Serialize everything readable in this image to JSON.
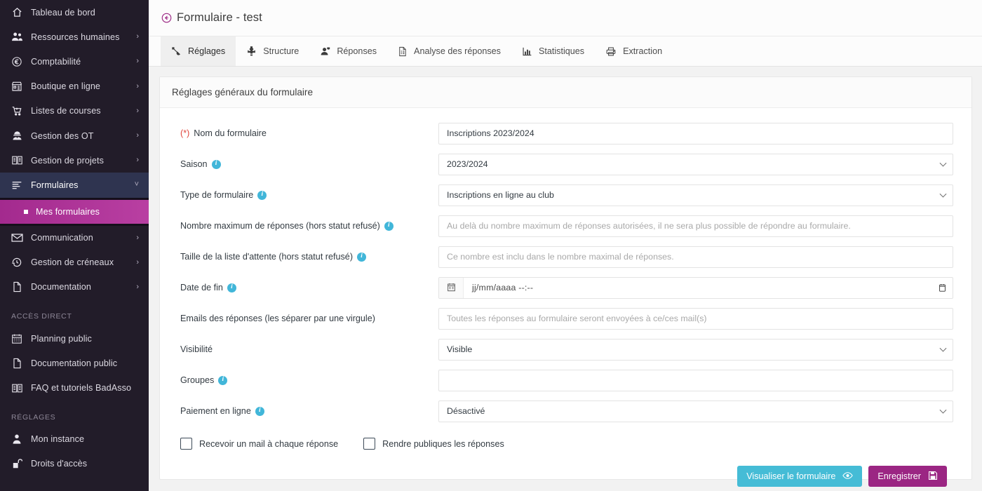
{
  "colors": {
    "sidebar_bg": "#221c29",
    "sidebar_active_parent": "#2f3450",
    "sidebar_active_sub": "#a32a8e",
    "accent_magenta": "#9b2683",
    "accent_cyan": "#45bcd6",
    "info_blue": "#41b6d9",
    "required_red": "#e0473e"
  },
  "sidebar": {
    "items": [
      {
        "label": "Tableau de bord",
        "icon": "home-icon",
        "expandable": false
      },
      {
        "label": "Ressources humaines",
        "icon": "users-icon",
        "expandable": true
      },
      {
        "label": "Comptabilité",
        "icon": "euro-circle-icon",
        "expandable": true
      },
      {
        "label": "Boutique en ligne",
        "icon": "shop-icon",
        "expandable": true
      },
      {
        "label": "Listes de courses",
        "icon": "shopping-cart-icon",
        "expandable": true
      },
      {
        "label": "Gestion des OT",
        "icon": "worker-icon",
        "expandable": true
      },
      {
        "label": "Gestion de projets",
        "icon": "projects-icon",
        "expandable": true
      },
      {
        "label": "Formulaires",
        "icon": "form-lines-icon",
        "expandable": true,
        "active": true
      },
      {
        "label": "Communication",
        "icon": "envelope-icon",
        "expandable": true
      },
      {
        "label": "Gestion de créneaux",
        "icon": "history-clock-icon",
        "expandable": true
      },
      {
        "label": "Documentation",
        "icon": "file-icon",
        "expandable": true
      }
    ],
    "sub_item": {
      "label": "Mes formulaires",
      "icon": "square-bullet-icon"
    },
    "section_acces_direct": "ACCÈS DIRECT",
    "acces_direct_items": [
      {
        "label": "Planning public",
        "icon": "calendar-icon"
      },
      {
        "label": "Documentation public",
        "icon": "file-icon"
      },
      {
        "label": "FAQ et tutoriels BadAsso",
        "icon": "book-icon"
      }
    ],
    "section_reglages": "RÉGLAGES",
    "reglages_items": [
      {
        "label": "Mon instance",
        "icon": "person-icon"
      },
      {
        "label": "Droits d'accès",
        "icon": "unlock-icon"
      }
    ]
  },
  "header": {
    "title": "Formulaire - test",
    "back_icon": "back-circle-arrow-icon"
  },
  "tabs": [
    {
      "label": "Réglages",
      "icon": "wrench-icon",
      "active": true
    },
    {
      "label": "Structure",
      "icon": "puzzle-icon",
      "active": false
    },
    {
      "label": "Réponses",
      "icon": "user-response-icon",
      "active": false
    },
    {
      "label": "Analyse des réponses",
      "icon": "document-analysis-icon",
      "active": false
    },
    {
      "label": "Statistiques",
      "icon": "bar-chart-icon",
      "active": false
    },
    {
      "label": "Extraction",
      "icon": "printer-icon",
      "active": false
    }
  ],
  "card": {
    "title": "Réglages généraux du formulaire",
    "fields": [
      {
        "key": "nom_formulaire",
        "required_marker": "(*)",
        "label": "Nom du formulaire",
        "has_info": false,
        "control": "text",
        "value": "Inscriptions 2023/2024",
        "placeholder": ""
      },
      {
        "key": "saison",
        "label": "Saison",
        "has_info": true,
        "control": "select",
        "value": "2023/2024"
      },
      {
        "key": "type_formulaire",
        "label": "Type de formulaire",
        "has_info": true,
        "control": "select",
        "value": "Inscriptions en ligne au club"
      },
      {
        "key": "nombre_max_reponses",
        "label": "Nombre maximum de réponses (hors statut refusé)",
        "has_info": true,
        "control": "text",
        "value": "",
        "placeholder": "Au delà du nombre maximum de réponses autorisées, il ne sera plus possible de répondre au formulaire."
      },
      {
        "key": "taille_liste_attente",
        "label": "Taille de la liste d'attente (hors statut refusé)",
        "has_info": true,
        "control": "text",
        "value": "",
        "placeholder": "Ce nombre est inclu dans le nombre maximal de réponses."
      },
      {
        "key": "date_de_fin",
        "label": "Date de fin",
        "has_info": true,
        "control": "datetime",
        "value": "jj/mm/aaaa --:--"
      },
      {
        "key": "emails_reponses",
        "label": "Emails des réponses (les séparer par une virgule)",
        "has_info": false,
        "control": "text",
        "value": "",
        "placeholder": "Toutes les réponses au formulaire seront envoyées à ce/ces mail(s)"
      },
      {
        "key": "visibilite",
        "label": "Visibilité",
        "has_info": false,
        "control": "select",
        "value": "Visible"
      },
      {
        "key": "groupes",
        "label": "Groupes",
        "has_info": true,
        "control": "text",
        "value": "",
        "placeholder": ""
      },
      {
        "key": "paiement_en_ligne",
        "label": "Paiement en ligne",
        "has_info": true,
        "control": "select",
        "value": "Désactivé"
      }
    ],
    "checkboxes": [
      {
        "label": "Recevoir un mail à chaque réponse",
        "checked": false
      },
      {
        "label": "Rendre publiques les réponses",
        "checked": false
      }
    ],
    "buttons": {
      "preview": {
        "label": "Visualiser le formulaire",
        "icon": "eye-icon"
      },
      "save": {
        "label": "Enregistrer",
        "icon": "floppy-disk-icon"
      }
    }
  }
}
